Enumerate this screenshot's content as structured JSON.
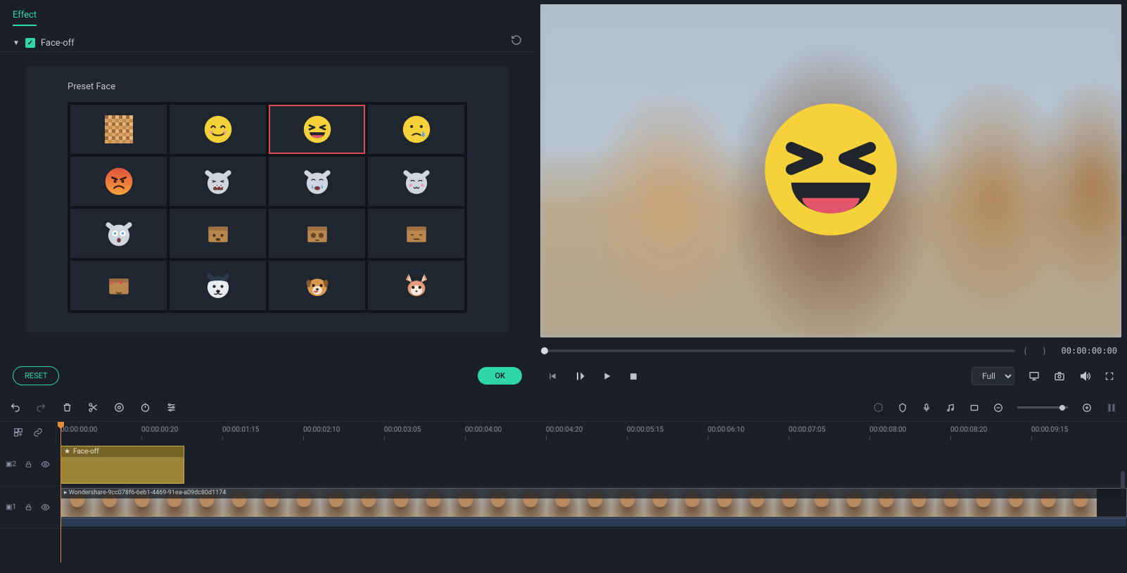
{
  "tabs": {
    "effect": "Effect"
  },
  "section": {
    "title": "Face-off"
  },
  "panel": {
    "preset_label": "Preset Face"
  },
  "presets": [
    {
      "name": "mosaic",
      "selected": false
    },
    {
      "name": "smile",
      "selected": false
    },
    {
      "name": "laughing",
      "selected": true
    },
    {
      "name": "crying",
      "selected": false
    },
    {
      "name": "angry",
      "selected": false
    },
    {
      "name": "cat-roar",
      "selected": false
    },
    {
      "name": "cat-tears",
      "selected": false
    },
    {
      "name": "cat-smile",
      "selected": false
    },
    {
      "name": "cat-shocked",
      "selected": false
    },
    {
      "name": "box-surprised",
      "selected": false
    },
    {
      "name": "box-dazed",
      "selected": false
    },
    {
      "name": "box-uneasy",
      "selected": false
    },
    {
      "name": "box-love",
      "selected": false
    },
    {
      "name": "husky",
      "selected": false
    },
    {
      "name": "puppy",
      "selected": false
    },
    {
      "name": "fennec",
      "selected": false
    }
  ],
  "buttons": {
    "reset": "RESET",
    "ok": "OK"
  },
  "preview": {
    "timecode": "00:00:00:00",
    "quality": "Full",
    "braces": "{   }"
  },
  "timeline": {
    "ticks": [
      "00:00:00:00",
      "00:00:00:20",
      "00:00:01:15",
      "00:00:02:10",
      "00:00:03:05",
      "00:00:04:00",
      "00:00:04:20",
      "00:00:05:15",
      "00:00:06:10",
      "00:00:07:05",
      "00:00:08:00",
      "00:00:08:20",
      "00:00:09:15"
    ],
    "tracks": {
      "fx": {
        "index": "2",
        "clip_label": "Face-off"
      },
      "video": {
        "index": "1",
        "clip_label": "Wondershare-9cc078f6-6eb1-4469-91ea-a09dc80d1174"
      }
    }
  }
}
